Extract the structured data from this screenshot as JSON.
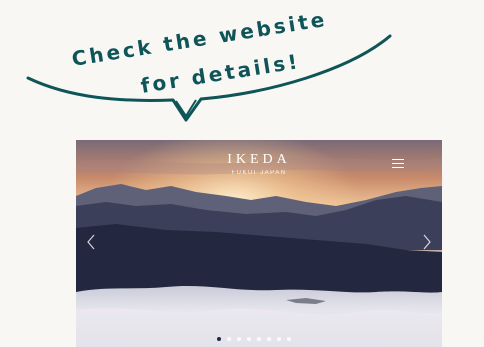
{
  "callout": {
    "line1": "Check the website",
    "line2": "for details!"
  },
  "hero": {
    "logo_title": "IKEDA",
    "logo_subtitle": "FUKUI JAPAN",
    "menu_icon": "hamburger-icon",
    "prev_icon": "chevron-left-icon",
    "next_icon": "chevron-right-icon",
    "slide_count": 8,
    "active_slide": 1
  },
  "colors": {
    "accent": "#0f5558",
    "background": "#f8f7f4",
    "active_dot": "#1f2a45"
  }
}
